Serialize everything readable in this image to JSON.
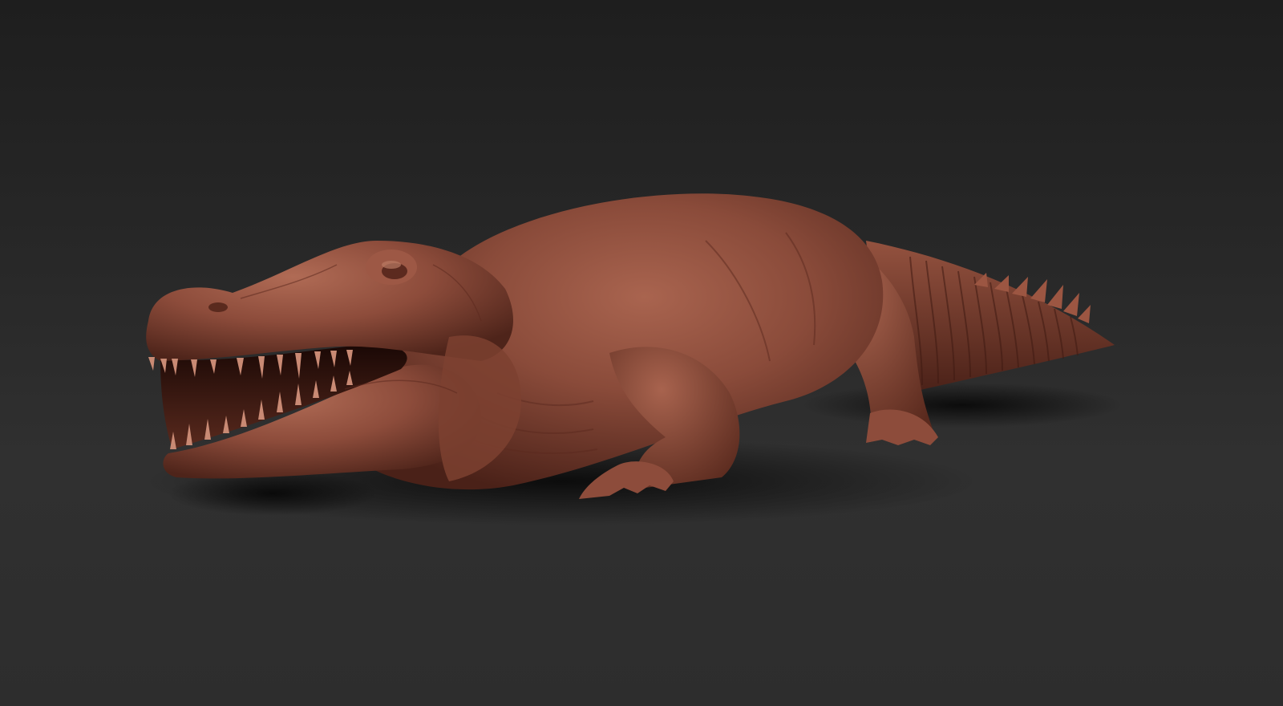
{
  "viewport": {
    "background_top": "#1e1e1e",
    "background_bottom": "#2f2f2f",
    "model": {
      "subject": "crocodilian-creature-sculpt",
      "material_color": "#8a4b3a",
      "highlight_color": "#b8735f",
      "shadow_color": "#4a2118",
      "teeth_color": "#c98a74"
    }
  }
}
